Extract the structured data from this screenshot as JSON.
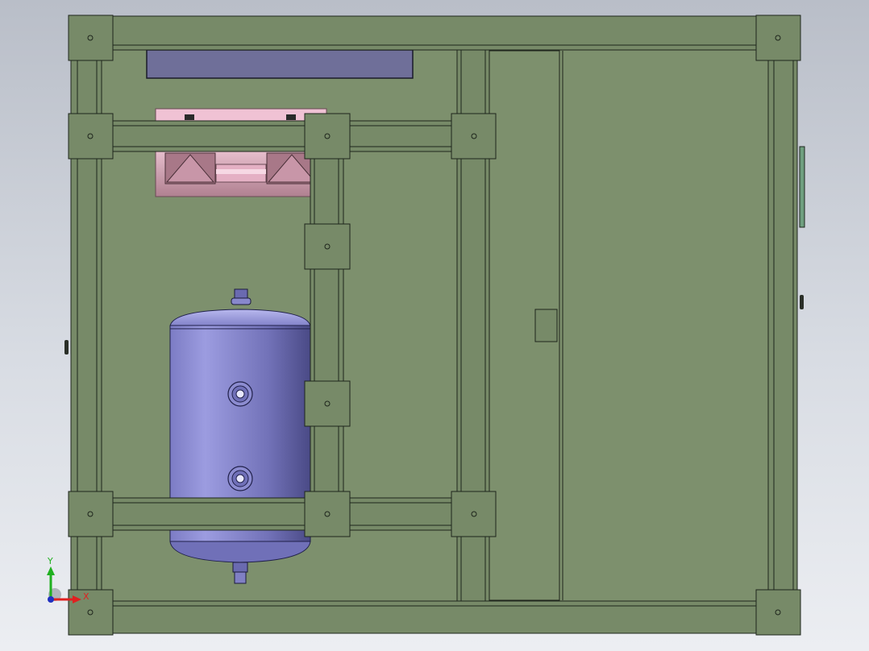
{
  "viewport": {
    "background_top": "#b9bec8",
    "background_bottom": "#eceef2"
  },
  "model": {
    "frame_color": "#778a68",
    "frame_edge_color": "#1e251c",
    "plate_color": "#7d906d",
    "tank_color": "#8f8fd0",
    "tank_shade_color": "#4c4a8a",
    "bracket_color": "#c99aa9",
    "bracket_light_color": "#f0c2d4",
    "top_bar_color": "#6f6f99",
    "side_tab_color": "#6f9f7f"
  },
  "triad": {
    "x_label": "X",
    "y_label": "Y",
    "x_color": "#e02020",
    "y_color": "#20b020",
    "z_color": "#2030c0"
  }
}
